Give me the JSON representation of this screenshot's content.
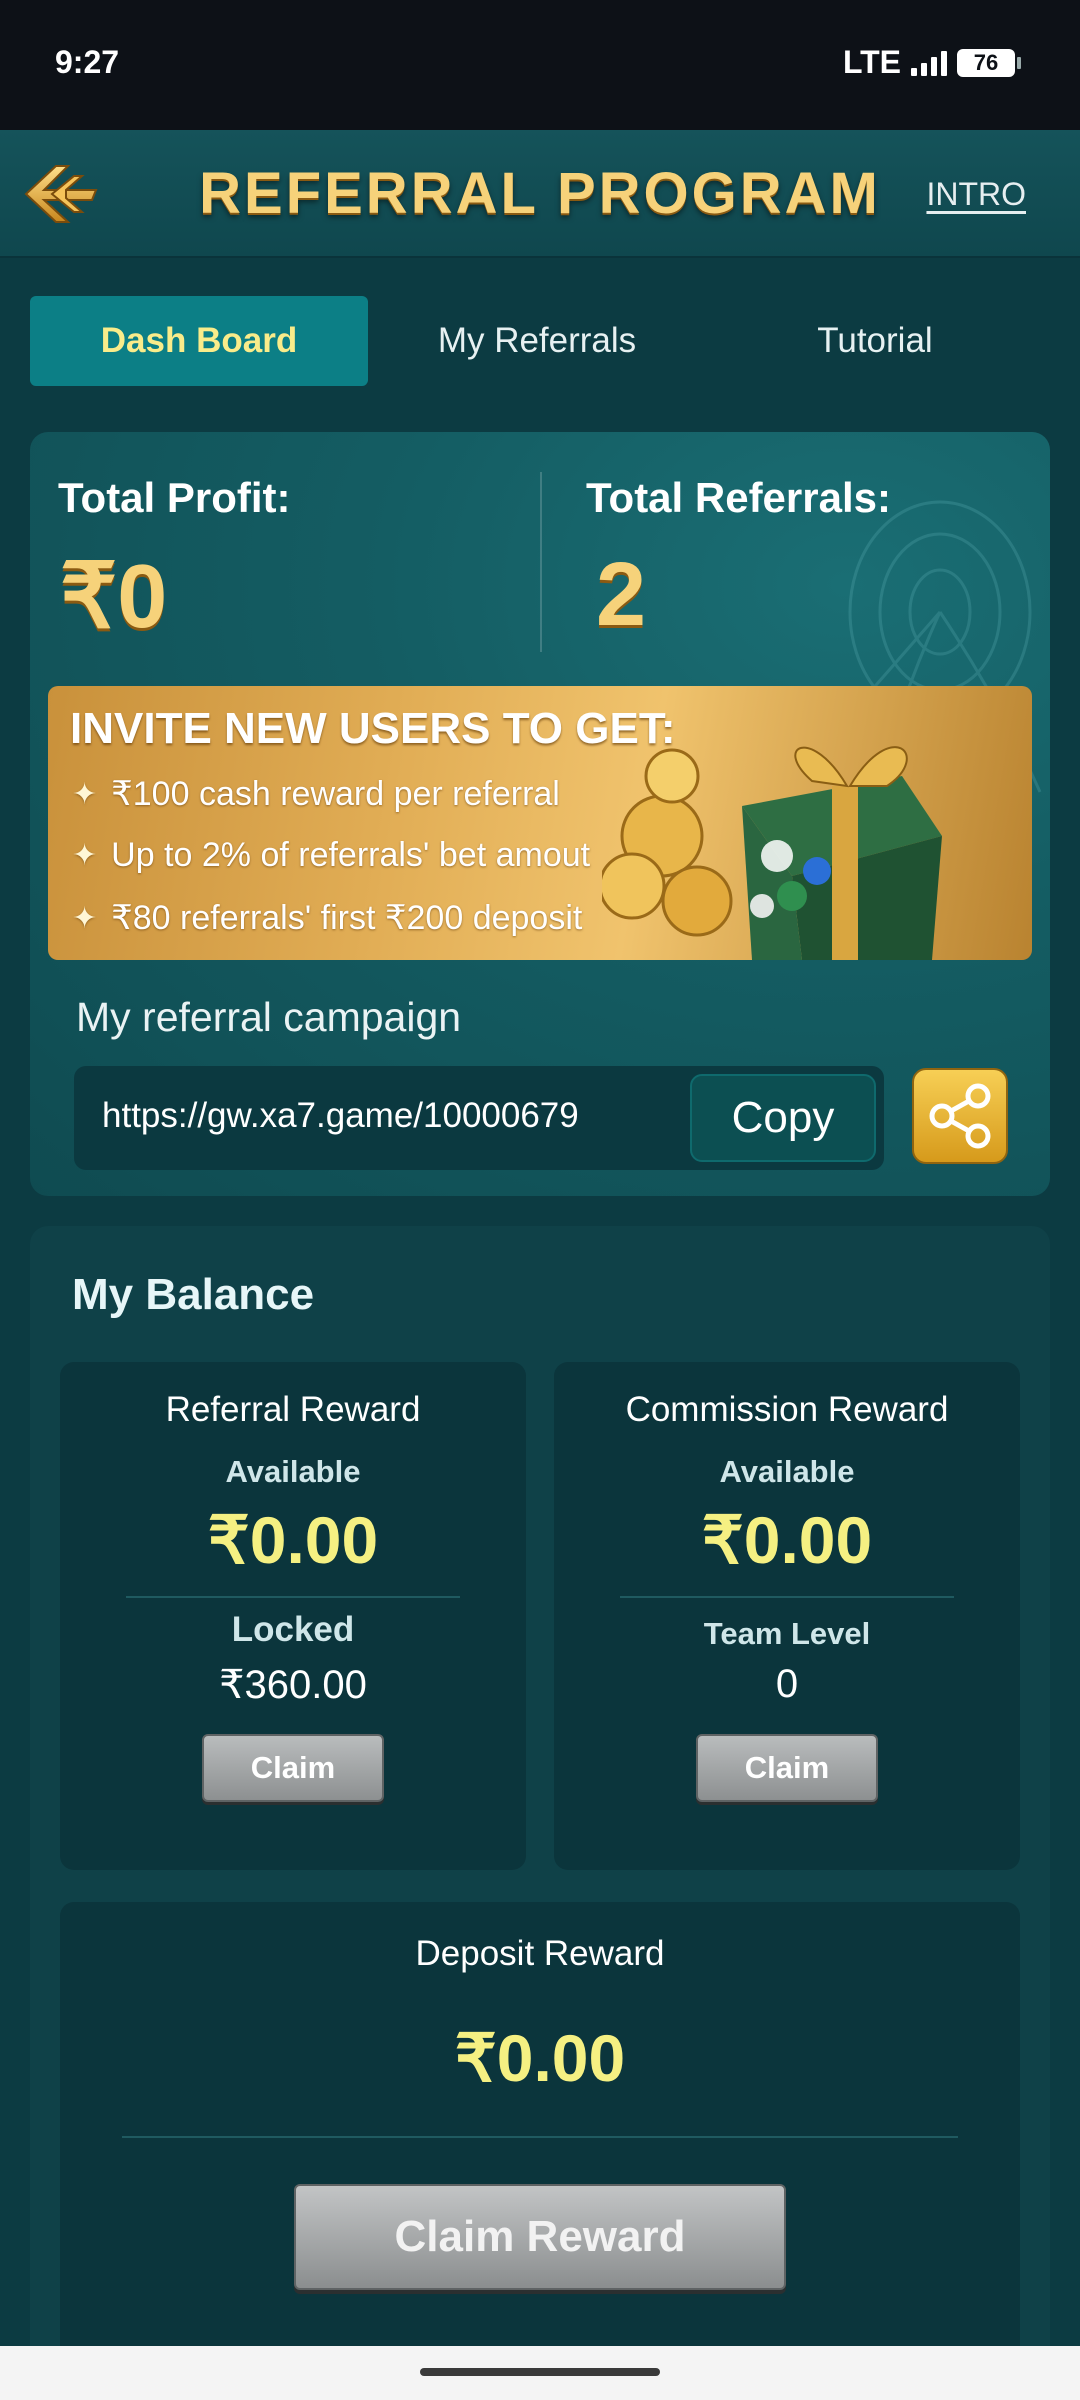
{
  "status_bar": {
    "time": "9:27",
    "network": "LTE",
    "battery": "76"
  },
  "header": {
    "title": "REFERRAL  PROGRAM",
    "intro_label": "INTRO",
    "back_icon": "back-arrow-icon"
  },
  "tabs": [
    {
      "label": "Dash Board",
      "active": true
    },
    {
      "label": "My Referrals",
      "active": false
    },
    {
      "label": "Tutorial",
      "active": false
    }
  ],
  "summary": {
    "total_profit_label": "Total Profit:",
    "total_profit_value": "₹0",
    "total_referrals_label": "Total Referrals:",
    "total_referrals_value": "2"
  },
  "invite": {
    "title": "INVITE NEW USERS TO GET:",
    "items": [
      "₹100  cash reward per referral",
      "Up to 2% of referrals' bet amout",
      "₹80 referrals' first ₹200 deposit"
    ]
  },
  "campaign": {
    "label": "My referral campaign",
    "link": "https://gw.xa7.game/10000679",
    "copy_label": "Copy",
    "share_icon": "share-icon"
  },
  "balance": {
    "title": "My Balance",
    "referral_reward": {
      "title": "Referral Reward",
      "available_label": "Available",
      "available_value": "₹0.00",
      "locked_label": "Locked",
      "locked_value": "₹360.00",
      "claim_label": "Claim"
    },
    "commission_reward": {
      "title": "Commission Reward",
      "available_label": "Available",
      "available_value": "₹0.00",
      "team_level_label": "Team Level",
      "team_level_value": "0",
      "claim_label": "Claim"
    },
    "deposit_reward": {
      "title": "Deposit Reward",
      "value": "₹0.00",
      "claim_label": "Claim Reward"
    }
  },
  "colors": {
    "background": "#0c3b42",
    "accent_gold": "#f6d27a",
    "amount_yellow": "#f5f082",
    "active_tab": "#0c7f86"
  }
}
